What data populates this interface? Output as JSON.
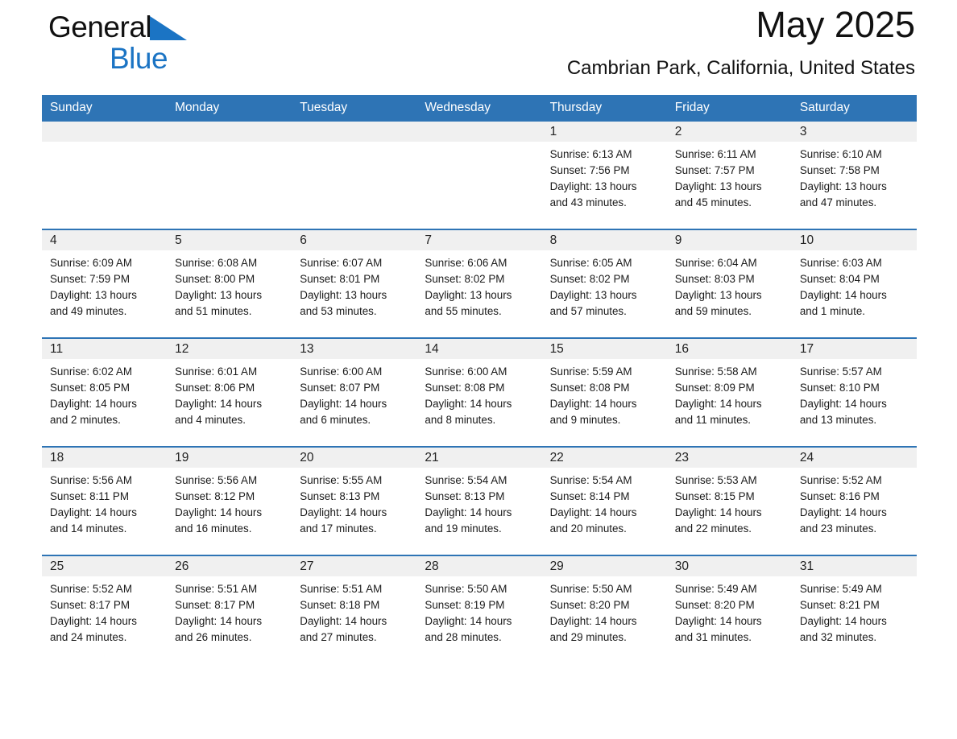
{
  "brand": {
    "name_part1": "General",
    "name_part2": "Blue",
    "accent_color": "#1B74C4"
  },
  "header": {
    "title": "May 2025",
    "subtitle": "Cambrian Park, California, United States"
  },
  "calendar": {
    "header_bg_color": "#2E74B5",
    "daynum_bg_color": "#F0F0F0",
    "weekday_headers": [
      "Sunday",
      "Monday",
      "Tuesday",
      "Wednesday",
      "Thursday",
      "Friday",
      "Saturday"
    ],
    "weeks": [
      [
        {
          "empty": true
        },
        {
          "empty": true
        },
        {
          "empty": true
        },
        {
          "empty": true
        },
        {
          "day": "1",
          "sunrise": "Sunrise: 6:13 AM",
          "sunset": "Sunset: 7:56 PM",
          "daylight_line1": "Daylight: 13 hours",
          "daylight_line2": "and 43 minutes."
        },
        {
          "day": "2",
          "sunrise": "Sunrise: 6:11 AM",
          "sunset": "Sunset: 7:57 PM",
          "daylight_line1": "Daylight: 13 hours",
          "daylight_line2": "and 45 minutes."
        },
        {
          "day": "3",
          "sunrise": "Sunrise: 6:10 AM",
          "sunset": "Sunset: 7:58 PM",
          "daylight_line1": "Daylight: 13 hours",
          "daylight_line2": "and 47 minutes."
        }
      ],
      [
        {
          "day": "4",
          "sunrise": "Sunrise: 6:09 AM",
          "sunset": "Sunset: 7:59 PM",
          "daylight_line1": "Daylight: 13 hours",
          "daylight_line2": "and 49 minutes."
        },
        {
          "day": "5",
          "sunrise": "Sunrise: 6:08 AM",
          "sunset": "Sunset: 8:00 PM",
          "daylight_line1": "Daylight: 13 hours",
          "daylight_line2": "and 51 minutes."
        },
        {
          "day": "6",
          "sunrise": "Sunrise: 6:07 AM",
          "sunset": "Sunset: 8:01 PM",
          "daylight_line1": "Daylight: 13 hours",
          "daylight_line2": "and 53 minutes."
        },
        {
          "day": "7",
          "sunrise": "Sunrise: 6:06 AM",
          "sunset": "Sunset: 8:02 PM",
          "daylight_line1": "Daylight: 13 hours",
          "daylight_line2": "and 55 minutes."
        },
        {
          "day": "8",
          "sunrise": "Sunrise: 6:05 AM",
          "sunset": "Sunset: 8:02 PM",
          "daylight_line1": "Daylight: 13 hours",
          "daylight_line2": "and 57 minutes."
        },
        {
          "day": "9",
          "sunrise": "Sunrise: 6:04 AM",
          "sunset": "Sunset: 8:03 PM",
          "daylight_line1": "Daylight: 13 hours",
          "daylight_line2": "and 59 minutes."
        },
        {
          "day": "10",
          "sunrise": "Sunrise: 6:03 AM",
          "sunset": "Sunset: 8:04 PM",
          "daylight_line1": "Daylight: 14 hours",
          "daylight_line2": "and 1 minute."
        }
      ],
      [
        {
          "day": "11",
          "sunrise": "Sunrise: 6:02 AM",
          "sunset": "Sunset: 8:05 PM",
          "daylight_line1": "Daylight: 14 hours",
          "daylight_line2": "and 2 minutes."
        },
        {
          "day": "12",
          "sunrise": "Sunrise: 6:01 AM",
          "sunset": "Sunset: 8:06 PM",
          "daylight_line1": "Daylight: 14 hours",
          "daylight_line2": "and 4 minutes."
        },
        {
          "day": "13",
          "sunrise": "Sunrise: 6:00 AM",
          "sunset": "Sunset: 8:07 PM",
          "daylight_line1": "Daylight: 14 hours",
          "daylight_line2": "and 6 minutes."
        },
        {
          "day": "14",
          "sunrise": "Sunrise: 6:00 AM",
          "sunset": "Sunset: 8:08 PM",
          "daylight_line1": "Daylight: 14 hours",
          "daylight_line2": "and 8 minutes."
        },
        {
          "day": "15",
          "sunrise": "Sunrise: 5:59 AM",
          "sunset": "Sunset: 8:08 PM",
          "daylight_line1": "Daylight: 14 hours",
          "daylight_line2": "and 9 minutes."
        },
        {
          "day": "16",
          "sunrise": "Sunrise: 5:58 AM",
          "sunset": "Sunset: 8:09 PM",
          "daylight_line1": "Daylight: 14 hours",
          "daylight_line2": "and 11 minutes."
        },
        {
          "day": "17",
          "sunrise": "Sunrise: 5:57 AM",
          "sunset": "Sunset: 8:10 PM",
          "daylight_line1": "Daylight: 14 hours",
          "daylight_line2": "and 13 minutes."
        }
      ],
      [
        {
          "day": "18",
          "sunrise": "Sunrise: 5:56 AM",
          "sunset": "Sunset: 8:11 PM",
          "daylight_line1": "Daylight: 14 hours",
          "daylight_line2": "and 14 minutes."
        },
        {
          "day": "19",
          "sunrise": "Sunrise: 5:56 AM",
          "sunset": "Sunset: 8:12 PM",
          "daylight_line1": "Daylight: 14 hours",
          "daylight_line2": "and 16 minutes."
        },
        {
          "day": "20",
          "sunrise": "Sunrise: 5:55 AM",
          "sunset": "Sunset: 8:13 PM",
          "daylight_line1": "Daylight: 14 hours",
          "daylight_line2": "and 17 minutes."
        },
        {
          "day": "21",
          "sunrise": "Sunrise: 5:54 AM",
          "sunset": "Sunset: 8:13 PM",
          "daylight_line1": "Daylight: 14 hours",
          "daylight_line2": "and 19 minutes."
        },
        {
          "day": "22",
          "sunrise": "Sunrise: 5:54 AM",
          "sunset": "Sunset: 8:14 PM",
          "daylight_line1": "Daylight: 14 hours",
          "daylight_line2": "and 20 minutes."
        },
        {
          "day": "23",
          "sunrise": "Sunrise: 5:53 AM",
          "sunset": "Sunset: 8:15 PM",
          "daylight_line1": "Daylight: 14 hours",
          "daylight_line2": "and 22 minutes."
        },
        {
          "day": "24",
          "sunrise": "Sunrise: 5:52 AM",
          "sunset": "Sunset: 8:16 PM",
          "daylight_line1": "Daylight: 14 hours",
          "daylight_line2": "and 23 minutes."
        }
      ],
      [
        {
          "day": "25",
          "sunrise": "Sunrise: 5:52 AM",
          "sunset": "Sunset: 8:17 PM",
          "daylight_line1": "Daylight: 14 hours",
          "daylight_line2": "and 24 minutes."
        },
        {
          "day": "26",
          "sunrise": "Sunrise: 5:51 AM",
          "sunset": "Sunset: 8:17 PM",
          "daylight_line1": "Daylight: 14 hours",
          "daylight_line2": "and 26 minutes."
        },
        {
          "day": "27",
          "sunrise": "Sunrise: 5:51 AM",
          "sunset": "Sunset: 8:18 PM",
          "daylight_line1": "Daylight: 14 hours",
          "daylight_line2": "and 27 minutes."
        },
        {
          "day": "28",
          "sunrise": "Sunrise: 5:50 AM",
          "sunset": "Sunset: 8:19 PM",
          "daylight_line1": "Daylight: 14 hours",
          "daylight_line2": "and 28 minutes."
        },
        {
          "day": "29",
          "sunrise": "Sunrise: 5:50 AM",
          "sunset": "Sunset: 8:20 PM",
          "daylight_line1": "Daylight: 14 hours",
          "daylight_line2": "and 29 minutes."
        },
        {
          "day": "30",
          "sunrise": "Sunrise: 5:49 AM",
          "sunset": "Sunset: 8:20 PM",
          "daylight_line1": "Daylight: 14 hours",
          "daylight_line2": "and 31 minutes."
        },
        {
          "day": "31",
          "sunrise": "Sunrise: 5:49 AM",
          "sunset": "Sunset: 8:21 PM",
          "daylight_line1": "Daylight: 14 hours",
          "daylight_line2": "and 32 minutes."
        }
      ]
    ]
  }
}
